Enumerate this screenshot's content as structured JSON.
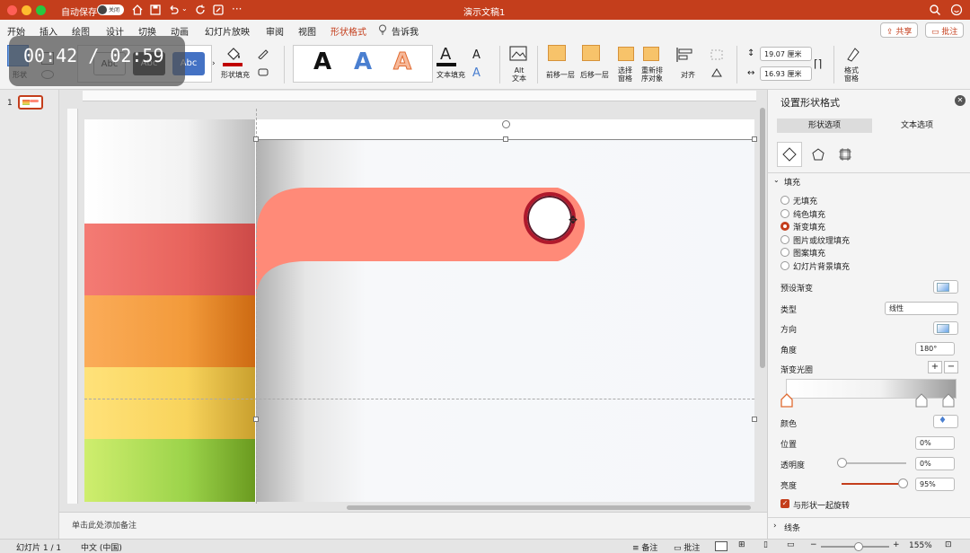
{
  "titlebar": {
    "autosave_label": "自动保存",
    "autosave_state": "关闭",
    "doc_title": "演示文稿1"
  },
  "menu": {
    "items": [
      "开始",
      "插入",
      "绘图",
      "设计",
      "切换",
      "动画",
      "幻灯片放映",
      "审阅",
      "视图",
      "形状格式"
    ],
    "tell_me": "告诉我",
    "share": "共享",
    "comment": "批注"
  },
  "ribbon": {
    "shape_label": "形状",
    "style_abc": "Abc",
    "shape_fill": "形状填充",
    "text_fill": "文本填充",
    "alt_text": "Alt\n文本",
    "bring_forward": "前移一层",
    "send_backward": "后移一层",
    "select_pane": "选择\n窗格",
    "reorder": "重新排\n序对象",
    "align": "对齐",
    "height": "19.07 厘米",
    "width": "16.93 厘米",
    "format_pane": "格式\n窗格",
    "wordart_A": "A"
  },
  "video_overlay": {
    "time": "00:42 / 02:59"
  },
  "slides": {
    "number": "1"
  },
  "notes": {
    "placeholder": "单击此处添加备注"
  },
  "pane": {
    "title": "设置形状格式",
    "tab_shape": "形状选项",
    "tab_text": "文本选项",
    "fill_section": "填充",
    "fill_options": [
      "无填充",
      "纯色填充",
      "渐变填充",
      "图片或纹理填充",
      "图案填充",
      "幻灯片背景填充"
    ],
    "fill_selected_index": 2,
    "preset_gradient": "预设渐变",
    "type_label": "类型",
    "type_value": "线性",
    "direction_label": "方向",
    "angle_label": "角度",
    "angle_value": "180°",
    "gradient_stops_label": "渐变光圈",
    "color_label": "颜色",
    "position_label": "位置",
    "position_value": "0%",
    "transparency_label": "透明度",
    "transparency_value": "0%",
    "transparency_slider": 0.0,
    "brightness_label": "亮度",
    "brightness_value": "95%",
    "brightness_slider": 0.95,
    "rotate_with_shape": "与形状一起旋转",
    "line_section": "线条"
  },
  "status": {
    "slide_count": "幻灯片 1 / 1",
    "language": "中文 (中国)",
    "notes_btn": "备注",
    "comments_btn": "批注",
    "zoom": "155%",
    "zoom_fraction": 0.55
  },
  "colors": {
    "accent": "#c43e1c",
    "salmon": "#ff8a78",
    "red_band": "#e8645d",
    "orange_band": "#f29a3a",
    "yellow_band": "#f8d35b",
    "green_band": "#9bd34a"
  }
}
